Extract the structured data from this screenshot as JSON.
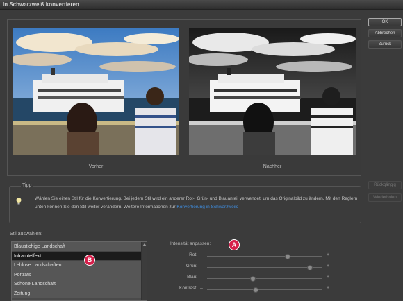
{
  "window": {
    "title": "In Schwarzweiß konvertieren"
  },
  "buttons": {
    "ok": "OK",
    "cancel": "Abbrechen",
    "reset": "Zurück",
    "undo": "Rückgängig",
    "redo": "Wiederholen"
  },
  "preview": {
    "before_label": "Vorher",
    "after_label": "Nachher"
  },
  "tip": {
    "label": "Tipp",
    "text": "Wählen Sie einen Stil für die Konvertierung. Bei jedem Stil wird ein anderer Rot-, Grün- und Blauanteil verwendet, um das Originalbild zu ändern. Mit den Reglern unten können Sie den Stil weiter verändern. Weitere Informationen zur",
    "link": "Konvertierung in Schwarzweiß"
  },
  "styles": {
    "label": "Stil auswählen:",
    "items": [
      "Blaustichige Landschaft",
      "Infraroteffekt",
      "Leblose Landschaften",
      "Porträts",
      "Schöne Landschaft",
      "Zeitung"
    ],
    "selected_index": 1
  },
  "intensity": {
    "label": "Intensität anpassen:",
    "sliders": [
      {
        "name": "Rot:",
        "value": 0.7
      },
      {
        "name": "Grün:",
        "value": 0.89
      },
      {
        "name": "Blau:",
        "value": 0.4
      },
      {
        "name": "Kontrast:",
        "value": 0.42
      }
    ]
  },
  "markers": {
    "a": "A",
    "b": "B"
  },
  "colors": {
    "marker": "#d6204b",
    "link": "#3f8ee0",
    "selected_row": "#1b1b1b"
  }
}
